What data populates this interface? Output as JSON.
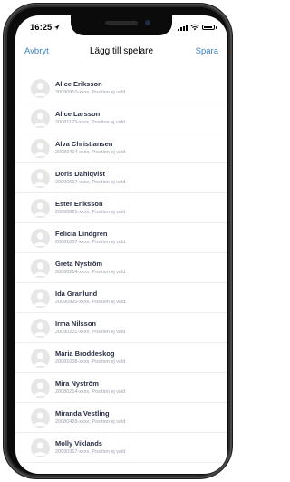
{
  "status": {
    "time": "16:25"
  },
  "nav": {
    "cancel": "Avbryt",
    "title": "Lägg till spelare",
    "save": "Spara"
  },
  "players": [
    {
      "name": "Alice Eriksson",
      "sub": "20090910-xxxx, Position ej vald"
    },
    {
      "name": "Alice Larsson",
      "sub": "20081123-xxxx, Position ej vald"
    },
    {
      "name": "Alva Christiansen",
      "sub": "20080404-xxxx, Position ej vald"
    },
    {
      "name": "Doris Dahlqvist",
      "sub": "20090617-xxxx, Position ej vald"
    },
    {
      "name": "Ester Eriksson",
      "sub": "20080821-xxxx, Position ej vald"
    },
    {
      "name": "Felicia Lindgren",
      "sub": "20081007-xxxx, Position ej vald"
    },
    {
      "name": "Greta Nyström",
      "sub": "20080214-xxxx, Position ej vald"
    },
    {
      "name": "Ida Granlund",
      "sub": "20090920-xxxx, Position ej vald"
    },
    {
      "name": "Irma Nilsson",
      "sub": "20090201-xxxx, Position ej vald"
    },
    {
      "name": "Maria Broddeskog",
      "sub": "20081008-xxxx, Position ej vald"
    },
    {
      "name": "Mira Nyström",
      "sub": "20080214-xxxx, Position ej vald"
    },
    {
      "name": "Miranda Vestling",
      "sub": "20080428-xxxx, Position ej vald"
    },
    {
      "name": "Molly Viklands",
      "sub": "20090317-xxxx, Position ej vald"
    }
  ],
  "colors": {
    "accent": "#3b82c4",
    "name": "#2a2f45",
    "sub": "#9aa0aa",
    "avatar_bg": "#e6e6e6"
  }
}
